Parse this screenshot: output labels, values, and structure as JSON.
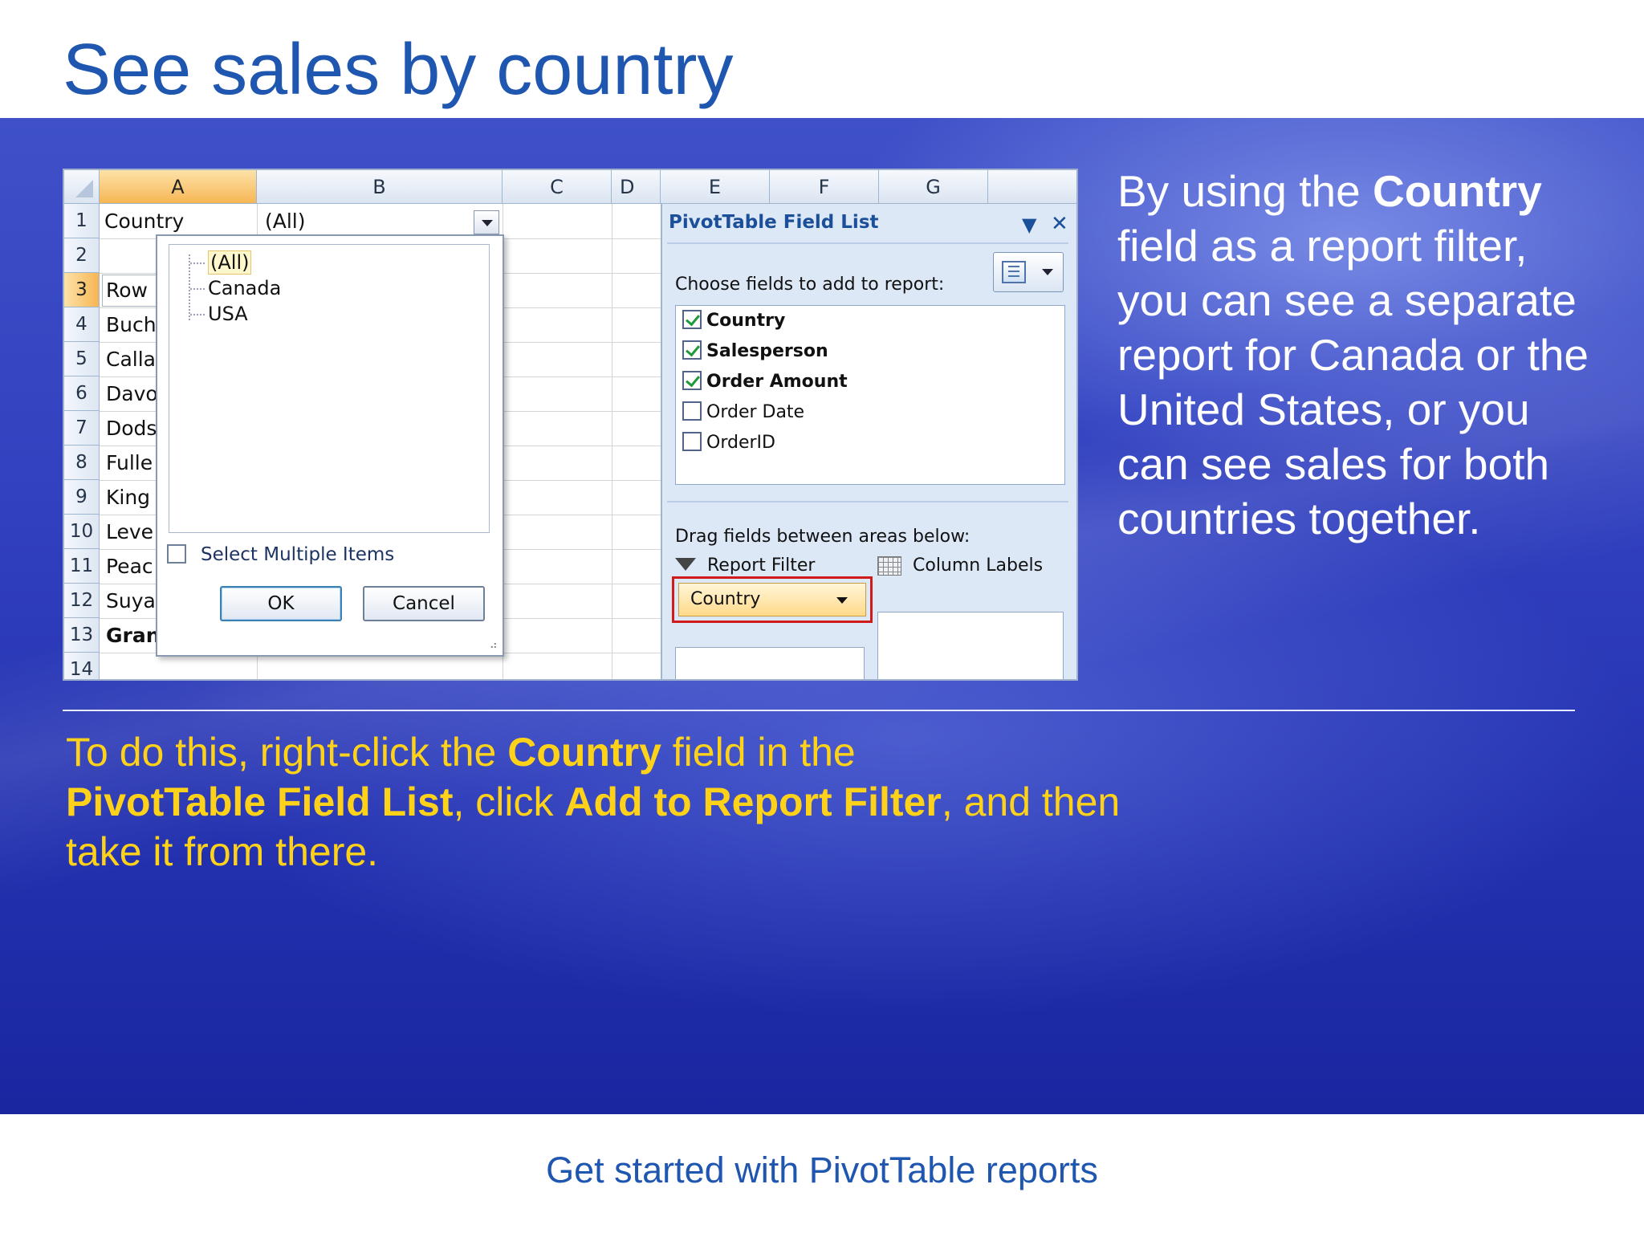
{
  "slide": {
    "title": "See sales by country",
    "side_text": {
      "pre": "By using the ",
      "bold": "Country",
      "post": " field as a report filter, you can see a separate report for Canada or the United States, or you can see sales for both countries together."
    },
    "instruction": {
      "p1": "To do this, right-click the ",
      "b1": "Country",
      "p2": " field in the ",
      "b2": "PivotTable Field List",
      "p3": ", click ",
      "b3": "Add to Report Filter",
      "p4": ", and then take it from there."
    },
    "footer": "Get started with PivotTable reports"
  },
  "sheet": {
    "columns": [
      "A",
      "B",
      "C",
      "D",
      "E",
      "F",
      "G"
    ],
    "active_column": "A",
    "rows": [
      "1",
      "2",
      "3",
      "4",
      "5",
      "6",
      "7",
      "8",
      "9",
      "10",
      "11",
      "12",
      "13",
      "14"
    ],
    "active_row": "3",
    "filter_label": "Country",
    "filter_value": "(All)",
    "cells": [
      "Row",
      "Buch",
      "Calla",
      "Davo",
      "Dods",
      "Fulle",
      "King",
      "Leve",
      "Peac",
      "Suya",
      "Gran"
    ]
  },
  "dropdown": {
    "items": [
      "(All)",
      "Canada",
      "USA"
    ],
    "selected": "(All)",
    "multi_label": "Select Multiple Items",
    "ok": "OK",
    "cancel": "Cancel"
  },
  "field_list": {
    "title": "PivotTable Field List",
    "choose_label": "Choose fields to add to report:",
    "fields": [
      {
        "name": "Country",
        "checked": true
      },
      {
        "name": "Salesperson",
        "checked": true
      },
      {
        "name": "Order Amount",
        "checked": true
      },
      {
        "name": "Order Date",
        "checked": false
      },
      {
        "name": "OrderID",
        "checked": false
      }
    ],
    "drag_label": "Drag fields between areas below:",
    "report_filter_label": "Report Filter",
    "column_labels_label": "Column Labels",
    "report_filter_item": "Country"
  },
  "colors": {
    "title_blue": "#1f56b0",
    "instruction_yellow": "#ffd21a",
    "highlight_red": "#d11a1a",
    "check_green": "#1f9a3a"
  },
  "icons": [
    "dropdown-arrow-icon",
    "mouse-pointer-icon",
    "close-icon",
    "layout-icon",
    "funnel-icon",
    "grid-icon",
    "checkmark-icon"
  ]
}
